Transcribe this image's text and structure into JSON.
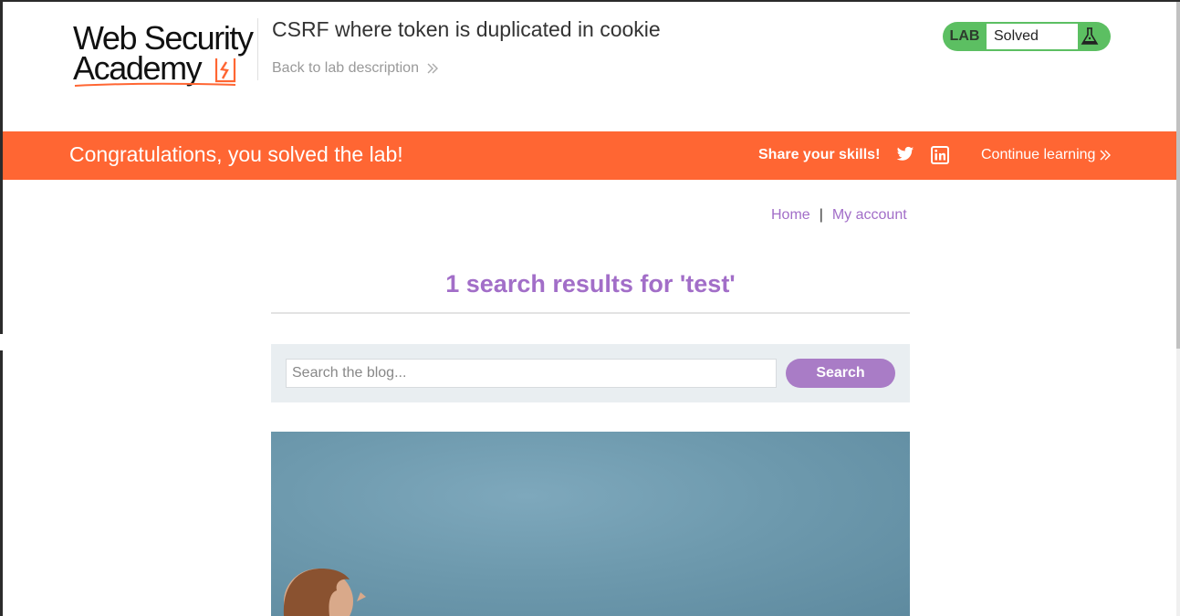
{
  "header": {
    "logo_line1": "Web Security",
    "logo_line2": "Academy",
    "lab_title": "CSRF where token is duplicated in cookie",
    "back_link": "Back to lab description",
    "status": {
      "badge": "LAB",
      "value": "Solved",
      "icon": "flask-icon"
    }
  },
  "banner": {
    "message": "Congratulations, you solved the lab!",
    "share_label": "Share your skills!",
    "continue_label": "Continue learning",
    "icons": [
      "twitter-icon",
      "linkedin-icon"
    ]
  },
  "nav": {
    "home": "Home",
    "separator": "|",
    "account": "My account"
  },
  "results": {
    "heading": "1 search results for 'test'"
  },
  "search": {
    "placeholder": "Search the blog...",
    "value": "",
    "button_label": "Search"
  },
  "post": {
    "image": "post-image"
  },
  "colors": {
    "accent_orange": "#ff6633",
    "accent_purple": "#a26ec8",
    "solved_green": "#5cbf62"
  }
}
